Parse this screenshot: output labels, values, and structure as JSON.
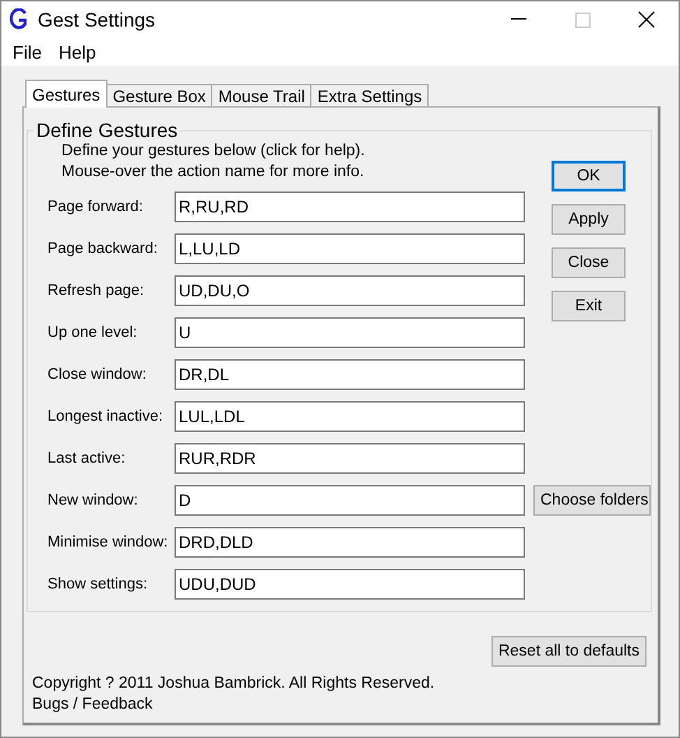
{
  "window": {
    "title": "Gest Settings"
  },
  "menu": [
    "File",
    "Help"
  ],
  "tabs": [
    {
      "label": "Gestures",
      "selected": true
    },
    {
      "label": "Gesture Box",
      "selected": false
    },
    {
      "label": "Mouse Trail",
      "selected": false
    },
    {
      "label": "Extra Settings",
      "selected": false
    }
  ],
  "group": {
    "title": "Define Gestures",
    "description": [
      "Define your gestures below (click for help).",
      "Mouse-over the action name for more info."
    ]
  },
  "gestures": [
    {
      "label": "Page forward:",
      "value": "R,RU,RD"
    },
    {
      "label": "Page backward:",
      "value": "L,LU,LD"
    },
    {
      "label": "Refresh page:",
      "value": "UD,DU,O"
    },
    {
      "label": "Up one level:",
      "value": "U"
    },
    {
      "label": "Close window:",
      "value": "DR,DL"
    },
    {
      "label": "Longest inactive:",
      "value": "LUL,LDL"
    },
    {
      "label": "Last active:",
      "value": "RUR,RDR"
    },
    {
      "label": "New window:",
      "value": "D",
      "button": "Choose folders"
    },
    {
      "label": "Minimise window:",
      "value": "DRD,DLD"
    },
    {
      "label": "Show settings:",
      "value": "UDU,DUD"
    }
  ],
  "buttons": [
    {
      "label": "OK",
      "default": true
    },
    {
      "label": "Apply",
      "default": false
    },
    {
      "label": "Close",
      "default": false
    },
    {
      "label": "Exit",
      "default": false
    }
  ],
  "reset_button": "Reset all to defaults",
  "copyright": "Copyright ? 2011 Joshua Bambrick. All Rights Reserved.",
  "feedback_link": "Bugs / Feedback"
}
